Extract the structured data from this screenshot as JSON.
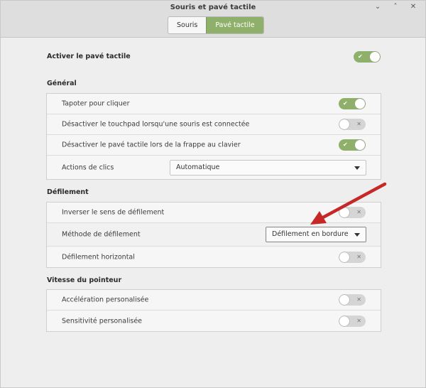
{
  "window": {
    "title": "Souris et pavé tactile",
    "controls": [
      "⌄",
      "˄",
      "✕"
    ]
  },
  "tabs": [
    {
      "label": "Souris",
      "active": false
    },
    {
      "label": "Pavé tactile",
      "active": true
    }
  ],
  "master": {
    "label": "Activer le pavé tactile",
    "enabled": true
  },
  "sections": {
    "general": {
      "title": "Général",
      "rows": [
        {
          "label": "Tapoter pour cliquer",
          "enabled": true
        },
        {
          "label": "Désactiver le touchpad lorsqu'une souris est connectée",
          "enabled": false
        },
        {
          "label": "Désactiver le pavé tactile lors de la frappe au clavier",
          "enabled": true
        },
        {
          "label": "Actions de clics",
          "selected": "Automatique"
        }
      ]
    },
    "scrolling": {
      "title": "Défilement",
      "rows": [
        {
          "label": "Inverser le sens de défilement",
          "enabled": false
        },
        {
          "label": "Méthode de défilement",
          "selected": "Défilement en bordure"
        },
        {
          "label": "Défilement horizontal",
          "enabled": false
        }
      ]
    },
    "pointer": {
      "title": "Vitesse du pointeur",
      "rows": [
        {
          "label": "Accélération personalisée",
          "enabled": false
        },
        {
          "label": "Sensitivité personalisée",
          "enabled": false
        }
      ]
    }
  },
  "marks": {
    "on": "✔",
    "off": "✕"
  },
  "colors": {
    "accent": "#8fb06a",
    "annotation_arrow": "#c62828"
  }
}
